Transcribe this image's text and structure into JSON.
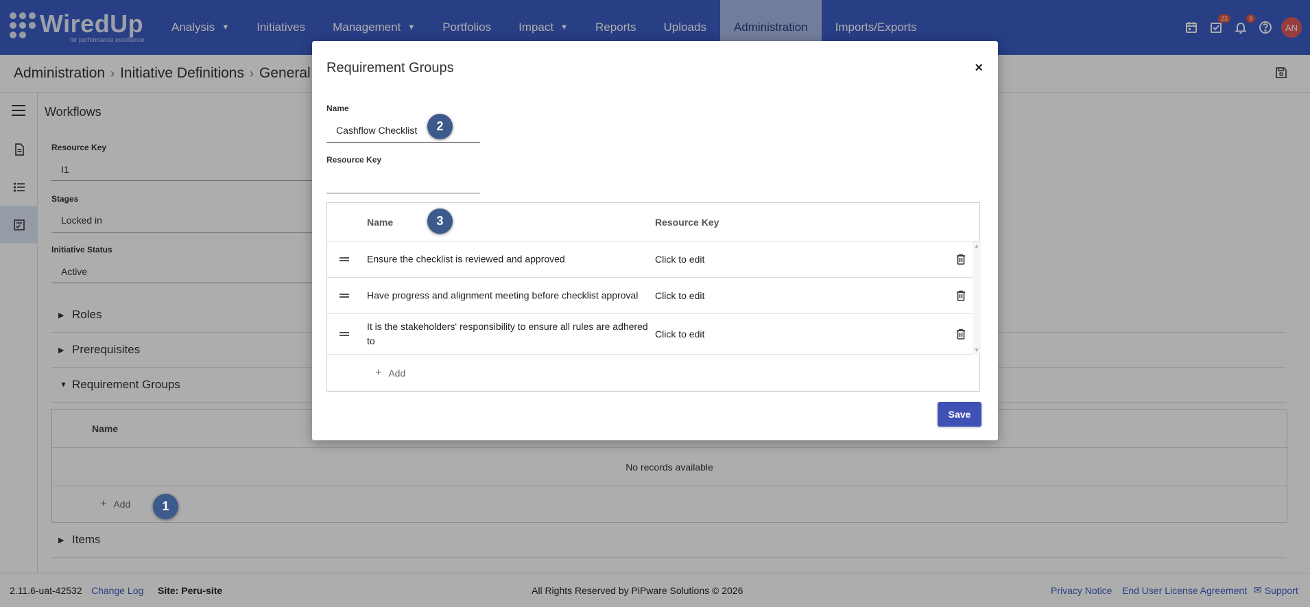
{
  "brand": {
    "name": "WiredUp",
    "tagline": "for performance excellence"
  },
  "nav": {
    "items": [
      {
        "label": "Analysis",
        "caret": true
      },
      {
        "label": "Initiatives",
        "caret": false
      },
      {
        "label": "Management",
        "caret": true
      },
      {
        "label": "Portfolios",
        "caret": false
      },
      {
        "label": "Impact",
        "caret": true
      },
      {
        "label": "Reports",
        "caret": false
      },
      {
        "label": "Uploads",
        "caret": false
      },
      {
        "label": "Administration",
        "caret": false,
        "active": true
      },
      {
        "label": "Imports/Exports",
        "caret": false
      }
    ],
    "tasks_badge": "23",
    "notifications_badge": "9",
    "avatar_initials": "AN"
  },
  "breadcrumb": {
    "items": [
      "Administration",
      "Initiative Definitions",
      "General I"
    ]
  },
  "page": {
    "title": "Workflows",
    "resource_key_label": "Resource Key",
    "resource_key_value": "I1",
    "stages_label": "Stages",
    "stages_value": "Locked in",
    "status_label": "Initiative Status",
    "status_value": "Active",
    "sections": {
      "roles": "Roles",
      "prerequisites": "Prerequisites",
      "requirement_groups": "Requirement Groups",
      "items": "Items"
    },
    "rg_table": {
      "name_header": "Name",
      "empty_text": "No records available",
      "add_label": "Add"
    }
  },
  "modal": {
    "title": "Requirement Groups",
    "close": "×",
    "name_label": "Name",
    "name_value": "Cashflow Checklist",
    "resource_key_label": "Resource Key",
    "resource_key_value": "",
    "table": {
      "name_header": "Name",
      "key_header": "Resource Key",
      "rows": [
        {
          "name": "Ensure the checklist is reviewed and approved",
          "key": "Click to edit"
        },
        {
          "name": "Have progress and alignment meeting before checklist approval",
          "key": "Click to edit"
        },
        {
          "name": "It is the stakeholders' responsibility to ensure all rules are adhered to",
          "key": "Click to edit"
        }
      ],
      "add_label": "Add"
    },
    "save_label": "Save"
  },
  "markers": [
    "1",
    "2",
    "3"
  ],
  "footer": {
    "version": "2.11.6-uat-42532",
    "change_log": "Change Log",
    "site": "Site: Peru-site",
    "rights": "All Rights Reserved by PiPware Solutions © 2026",
    "privacy": "Privacy Notice",
    "eula": "End User License Agreement",
    "support": "Support"
  },
  "colors": {
    "nav_bg": "#3b5cc4",
    "primary_button": "#3f51b5",
    "marker": "#3d5a8c",
    "badge": "#e0563a"
  }
}
